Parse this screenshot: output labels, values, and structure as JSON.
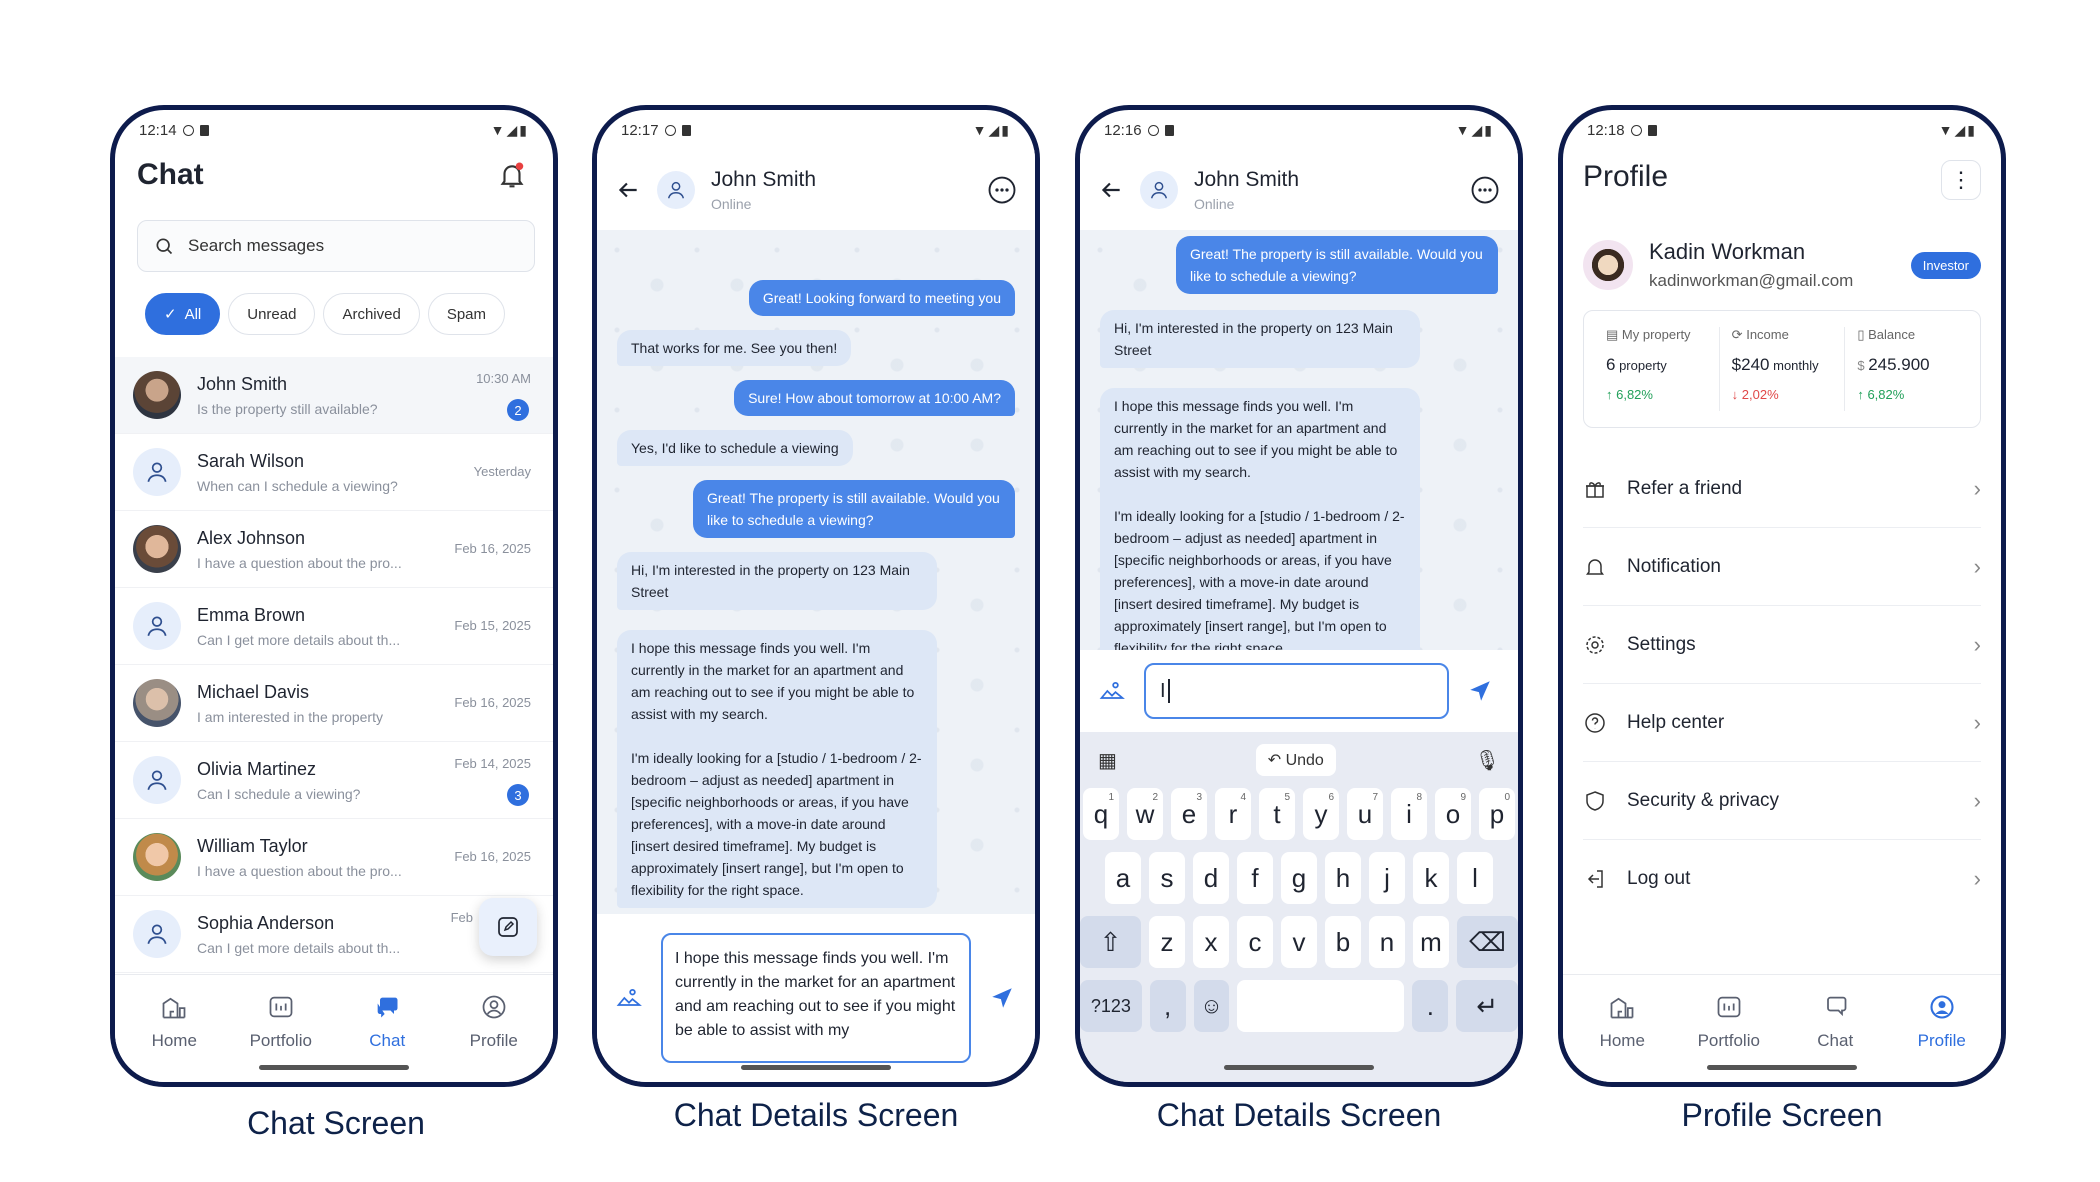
{
  "captions": [
    "Chat Screen",
    "Chat Details Screen",
    "Chat Details Screen",
    "Profile Screen"
  ],
  "screen1": {
    "time": "12:14",
    "title": "Chat",
    "search_placeholder": "Search messages",
    "chips": [
      "All",
      "Unread",
      "Archived",
      "Spam"
    ],
    "chats": [
      {
        "name": "John Smith",
        "msg": "Is the property still available?",
        "time": "10:30 AM",
        "badge": "2"
      },
      {
        "name": "Sarah Wilson",
        "msg": "When can I schedule a viewing?",
        "time": "Yesterday",
        "badge": ""
      },
      {
        "name": "Alex Johnson",
        "msg": "I have a question about the pro...",
        "time": "Feb 16, 2025",
        "badge": ""
      },
      {
        "name": "Emma Brown",
        "msg": "Can I get more details about th...",
        "time": "Feb 15, 2025",
        "badge": ""
      },
      {
        "name": "Michael Davis",
        "msg": "I am interested in the property",
        "time": "Feb 16, 2025",
        "badge": ""
      },
      {
        "name": "Olivia Martinez",
        "msg": "Can I schedule a viewing?",
        "time": "Feb 14, 2025",
        "badge": "3"
      },
      {
        "name": "William Taylor",
        "msg": "I have a question about the pro...",
        "time": "Feb 16, 2025",
        "badge": ""
      },
      {
        "name": "Sophia Anderson",
        "msg": "Can I get more details about th...",
        "time": "Feb",
        "badge": ""
      }
    ]
  },
  "nav": {
    "home": "Home",
    "portfolio": "Portfolio",
    "chat": "Chat",
    "profile": "Profile"
  },
  "screen2": {
    "time": "12:17",
    "contact": "John Smith",
    "status": "Online",
    "messages": [
      "Great! Looking forward to meeting you",
      "That works for me. See you then!",
      "Sure! How about tomorrow at 10:00 AM?",
      "Yes, I'd like to schedule a viewing",
      "Great! The property is still available. Would you like to schedule a viewing?",
      "Hi, I'm interested in the property on 123 Main Street",
      "I hope this message finds you well. I'm currently in the market for an apartment and am reaching out to see if you might be able to assist with my search.\n\nI'm ideally looking for a [studio / 1-bedroom / 2-bedroom – adjust as needed] apartment in [specific neighborhoods or areas, if you have preferences], with a move-in date around [insert desired timeframe]. My budget is approximately [insert range], but I'm open to flexibility for the right space."
    ],
    "draft": "I hope this message finds you well. I'm currently in the market for an apartment and am reaching out to see if you might be able to assist with my"
  },
  "screen3": {
    "time": "12:16",
    "contact": "John Smith",
    "status": "Online",
    "draft": "I",
    "undo": "Undo",
    "row1": [
      "q",
      "w",
      "e",
      "r",
      "t",
      "y",
      "u",
      "i",
      "o",
      "p"
    ],
    "row1_num": [
      "1",
      "2",
      "3",
      "4",
      "5",
      "6",
      "7",
      "8",
      "9",
      "0"
    ],
    "row2": [
      "a",
      "s",
      "d",
      "f",
      "g",
      "h",
      "j",
      "k",
      "l"
    ],
    "row3": [
      "z",
      "x",
      "c",
      "v",
      "b",
      "n",
      "m"
    ],
    "sym": "?123",
    "comma": ",",
    "period": "."
  },
  "screen4": {
    "time": "12:18",
    "title": "Profile",
    "name": "Kadin Workman",
    "email": "kadinworkman@gmail.com",
    "badge": "Investor",
    "stats": [
      {
        "label": "My property",
        "value": "6",
        "unit": " property",
        "change": "↑ 6,82%",
        "dir": "up"
      },
      {
        "label": "Income",
        "value": "$240",
        "unit": " monthly",
        "change": "↓ 2,02%",
        "dir": "down"
      },
      {
        "label": "Balance",
        "value": "245.900",
        "prefix": "$ ",
        "unit": "",
        "change": "↑ 6,82%",
        "dir": "up"
      }
    ],
    "menu": [
      "Refer a friend",
      "Notification",
      "Settings",
      "Help center",
      "Security & privacy",
      "Log out"
    ]
  },
  "colors": {
    "accent": "#2f6fde",
    "frame": "#0d1b4c",
    "up": "#22a05a",
    "down": "#e04848"
  }
}
